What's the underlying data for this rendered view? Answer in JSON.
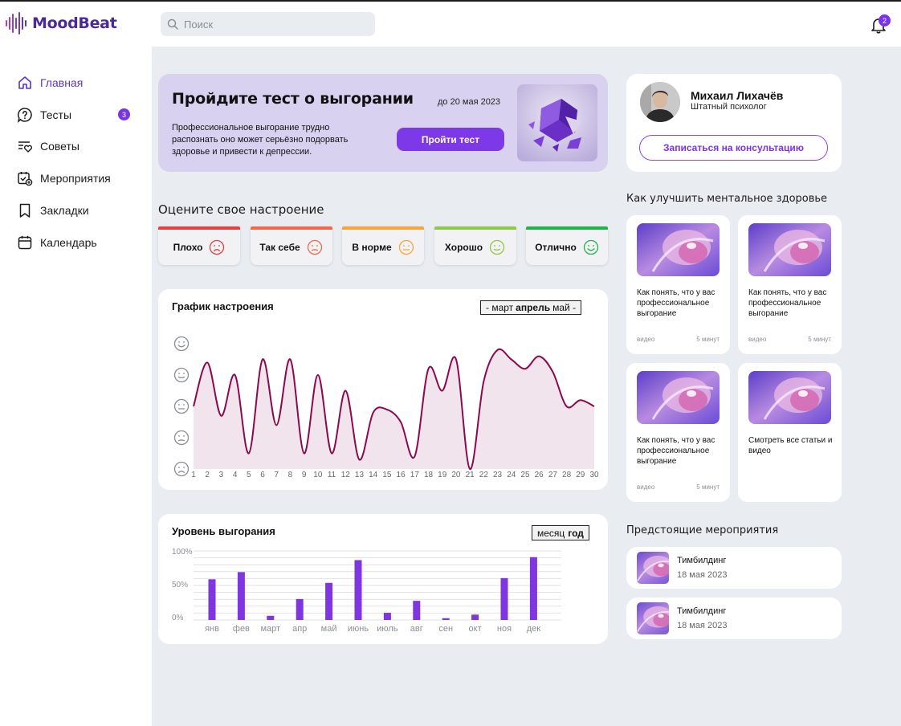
{
  "app": {
    "name": "MoodBeat"
  },
  "search": {
    "placeholder": "Поиск"
  },
  "notifications": {
    "count": "2"
  },
  "sidebar": {
    "items": [
      {
        "label": "Главная",
        "icon": "home-icon",
        "active": true
      },
      {
        "label": "Тесты",
        "icon": "question-bubble-icon",
        "badge": "3"
      },
      {
        "label": "Советы",
        "icon": "list-heart-icon"
      },
      {
        "label": "Мероприятия",
        "icon": "calendar-plus-icon"
      },
      {
        "label": "Закладки",
        "icon": "bookmark-icon"
      },
      {
        "label": "Календарь",
        "icon": "calendar-icon"
      }
    ]
  },
  "banner": {
    "title": "Пройдите тест о выгорании",
    "deadline": "до 20 мая 2023",
    "text": "Профессиональное выгорание трудно распознать оно может серьёзно подорвать здоровье и привести к депрессии.",
    "button": "Пройти тест"
  },
  "profile": {
    "name": "Михаил Лихачёв",
    "role": "Штатный психолог",
    "button": "Записаться на консультацию"
  },
  "mood_section": {
    "title": "Оцените свое настроение",
    "options": [
      {
        "label": "Плохо",
        "color": "#e53f3f"
      },
      {
        "label": "Так себе",
        "color": "#f0694a"
      },
      {
        "label": "В норме",
        "color": "#f5a53a"
      },
      {
        "label": "Хорошо",
        "color": "#8fc749"
      },
      {
        "label": "Отлично",
        "color": "#22b24c"
      }
    ]
  },
  "mood_chart": {
    "title": "График настроения",
    "months": {
      "prev": "- март",
      "current": "апрель",
      "next": "май -"
    }
  },
  "burnout": {
    "title": "Уровень выгорания",
    "period": {
      "month": "месяц",
      "year": "год"
    }
  },
  "articles": {
    "title": "Как улучшить ментальное здоровье",
    "items": [
      {
        "title": "Как понять, что у вас профессиональное выгорание",
        "type": "видео",
        "duration": "5 минут"
      },
      {
        "title": "Как понять, что у вас профессиональное выгорание",
        "type": "видео",
        "duration": "5 минут"
      },
      {
        "title": "Как понять, что у вас профессиональное выгорание",
        "type": "видео",
        "duration": "5 минут"
      }
    ],
    "see_all": "Смотреть все статьи и видео"
  },
  "events": {
    "title": "Предстоящие мероприятия",
    "items": [
      {
        "title": "Тимбилдинг",
        "date": "18 мая 2023"
      },
      {
        "title": "Тимбилдинг",
        "date": "18 мая 2023"
      }
    ]
  },
  "chart_data": [
    {
      "type": "area",
      "x": [
        1,
        2,
        3,
        4,
        5,
        6,
        7,
        8,
        9,
        10,
        11,
        12,
        13,
        14,
        15,
        16,
        17,
        18,
        19,
        20,
        21,
        22,
        23,
        24,
        25,
        26,
        27,
        28,
        29,
        30
      ],
      "values": [
        3.0,
        4.4,
        2.7,
        4.0,
        1.5,
        4.5,
        2.4,
        4.5,
        1.5,
        4.0,
        1.5,
        3.5,
        1.3,
        2.8,
        2.9,
        2.5,
        1.4,
        4.2,
        3.5,
        4.5,
        1.0,
        3.8,
        4.8,
        4.5,
        4.2,
        4.6,
        4.1,
        3.0,
        3.2,
        3.0
      ],
      "ylim": [
        1,
        5
      ],
      "y_ticks": [
        "sad",
        "meh",
        "neutral",
        "ok",
        "happy"
      ],
      "color": "#8a0a4f",
      "fill": "#f2e4ec"
    },
    {
      "type": "bar",
      "categories": [
        "янв",
        "фев",
        "март",
        "апр",
        "май",
        "июнь",
        "июль",
        "авг",
        "сен",
        "окт",
        "ноя",
        "дек"
      ],
      "values": [
        68,
        80,
        7,
        35,
        62,
        100,
        12,
        32,
        3,
        9,
        70,
        105
      ],
      "ylim": [
        0,
        110
      ],
      "y_tick_labels": [
        "100%",
        "50%",
        "0%"
      ],
      "color": "#7f35e0",
      "grid": true
    }
  ]
}
